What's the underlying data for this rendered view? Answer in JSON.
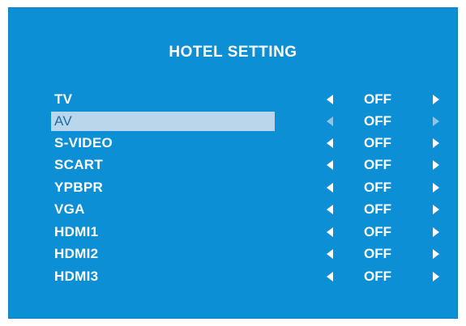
{
  "title": "HOTEL SETTING",
  "colors": {
    "background": "#0d8fd6",
    "highlight": "#b9d6ea",
    "text": "#ffffff"
  },
  "selected_index": 1,
  "items": [
    {
      "label": "TV",
      "value": "OFF",
      "left_icon": "left-arrow-icon",
      "right_icon": "right-arrow-icon"
    },
    {
      "label": "AV",
      "value": "OFF",
      "left_icon": "left-arrow-icon",
      "right_icon": "right-arrow-icon"
    },
    {
      "label": "S-VIDEO",
      "value": "OFF",
      "left_icon": "left-arrow-icon",
      "right_icon": "right-arrow-icon"
    },
    {
      "label": "SCART",
      "value": "OFF",
      "left_icon": "left-arrow-icon",
      "right_icon": "right-arrow-icon"
    },
    {
      "label": "YPBPR",
      "value": "OFF",
      "left_icon": "left-arrow-icon",
      "right_icon": "right-arrow-icon"
    },
    {
      "label": "VGA",
      "value": "OFF",
      "left_icon": "left-arrow-icon",
      "right_icon": "right-arrow-icon"
    },
    {
      "label": "HDMI1",
      "value": "OFF",
      "left_icon": "left-arrow-icon",
      "right_icon": "right-arrow-icon"
    },
    {
      "label": "HDMI2",
      "value": "OFF",
      "left_icon": "left-arrow-icon",
      "right_icon": "right-arrow-icon"
    },
    {
      "label": "HDMI3",
      "value": "OFF",
      "left_icon": "left-arrow-icon",
      "right_icon": "right-arrow-icon"
    }
  ]
}
